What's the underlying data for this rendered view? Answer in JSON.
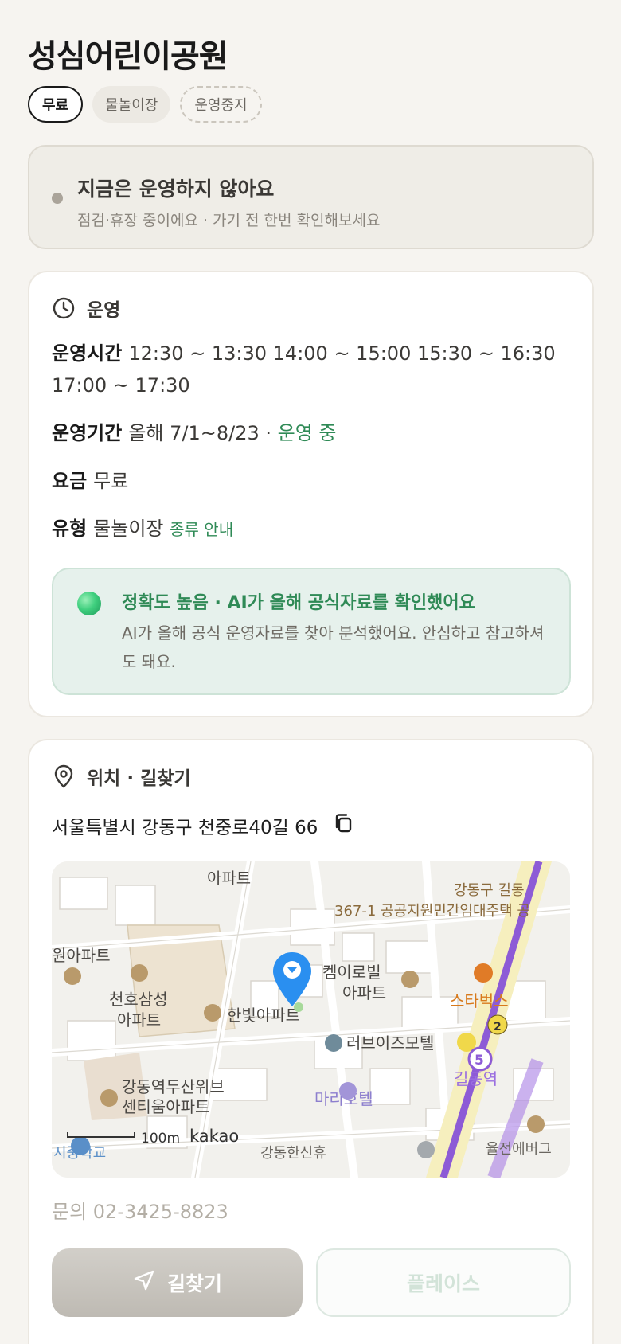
{
  "page": {
    "title": "성심어린이공원"
  },
  "chips": {
    "free": "무료",
    "type": "물놀이장",
    "status": "운영중지"
  },
  "notice": {
    "title": "지금은 운영하지 않아요",
    "subtitle": "점검·휴장 중이에요 · 가기 전 한번 확인해보세요"
  },
  "operation": {
    "section_label": "운영",
    "hours_key": "운영시간",
    "hours_value": "12:30 ~ 13:30 14:00 ~ 15:00 15:30 ~ 16:30 17:00 ~ 17:30",
    "period_key": "운영기간",
    "period_value": "올해 7/1~8/23 · ",
    "period_status": "운영 중",
    "fee_key": "요금",
    "fee_value": "무료",
    "type_key": "유형",
    "type_value": "물놀이장",
    "type_link": "종류 안내",
    "ai_title": "정확도 높음 · AI가 올해 공식자료를 확인했어요",
    "ai_text": "AI가 올해 공식 운영자료를 찾아 분석했어요. 안심하고 참고하셔도 돼요."
  },
  "location": {
    "section_label": "위치 · 길찾기",
    "address": "서울특별시 강동구 천중로40길 66",
    "map_labels": {
      "top_apt": "아파트",
      "housing1": "강동구 길동",
      "housing2": "367-1 공공지원민간임대주택 공",
      "won_apt": "원아파트",
      "cheonho1": "천호삼성",
      "cheonho2": "아파트",
      "hanbit": "한빛아파트",
      "kemiro1": "켐이로빌",
      "kemiro2": "아파트",
      "starbucks": "스타벅스",
      "loveis": "러브이즈모텔",
      "gildong_station": "길동역",
      "line_badge": "5",
      "exit_badge": "2",
      "mari": "마리호텔",
      "dusan1": "강동역두산위브",
      "dusan2": "센티움아파트",
      "school": "시중학교",
      "scale": "100m",
      "kakao": "kakao",
      "bottom_center": "강동한신휴",
      "bottom_right": "율전에버그"
    },
    "contact": "문의 02-3425-8823",
    "directions_button": "길찾기",
    "place_button": "플레이스"
  },
  "colors": {
    "accent_green": "#2f8a56",
    "marker_blue": "#2a8ff0",
    "subway_purple": "#8d5bd6"
  }
}
